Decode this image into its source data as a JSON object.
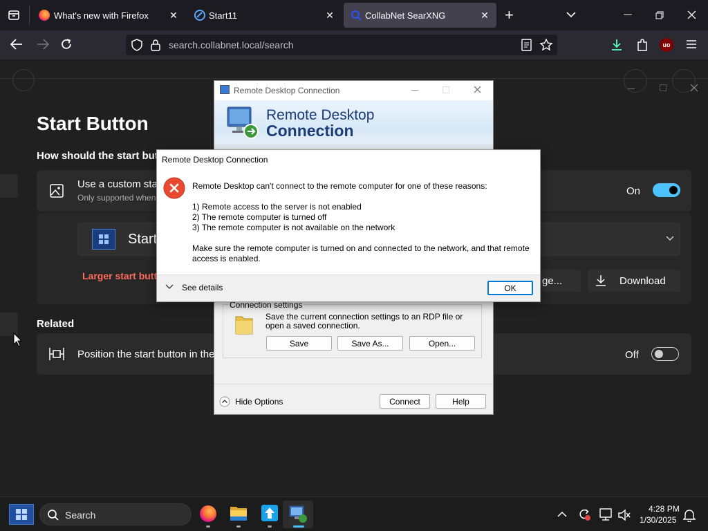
{
  "browser": {
    "tabs": [
      {
        "title": "What's new with Firefox"
      },
      {
        "title": "Start11"
      },
      {
        "title": "CollabNet SearXNG"
      }
    ],
    "url": "search.collabnet.local/search"
  },
  "start11": {
    "heading": "Start Button",
    "question": "How should the start butto",
    "custom_title": "Use a custom star",
    "custom_sub": "Only supported when",
    "custom_toggle_state": "On",
    "start_preview_label": "Start",
    "larger_warning": "Larger start butt",
    "manage_label": "ge...",
    "download_label": "Download",
    "related_heading": "Related",
    "position_label": "Position the start button in the",
    "position_toggle_state": "Off",
    "accent_red": "#ff6b5e",
    "toggle_on_color": "#4cc2ff"
  },
  "rdp_main": {
    "title": "Remote Desktop Connection",
    "banner_line1": "Remote Desktop",
    "banner_line2": "Connection",
    "settings_group": "Connection settings",
    "settings_desc": "Save the current connection settings to an RDP file or open a saved connection.",
    "save": "Save",
    "save_as": "Save As...",
    "open": "Open...",
    "hide_options": "Hide Options",
    "connect": "Connect",
    "help": "Help"
  },
  "rdp_error": {
    "title": "Remote Desktop Connection",
    "message": "Remote Desktop can't connect to the remote computer for one of these reasons:",
    "reasons": [
      "1) Remote access to the server is not enabled",
      "2) The remote computer is turned off",
      "3) The remote computer is not available on the network"
    ],
    "advice": "Make sure the remote computer is turned on and connected to the network, and that remote access is enabled.",
    "see_details": "See details",
    "ok": "OK"
  },
  "taskbar": {
    "search_placeholder": "Search",
    "time": "4:28 PM",
    "date": "1/30/2025"
  }
}
